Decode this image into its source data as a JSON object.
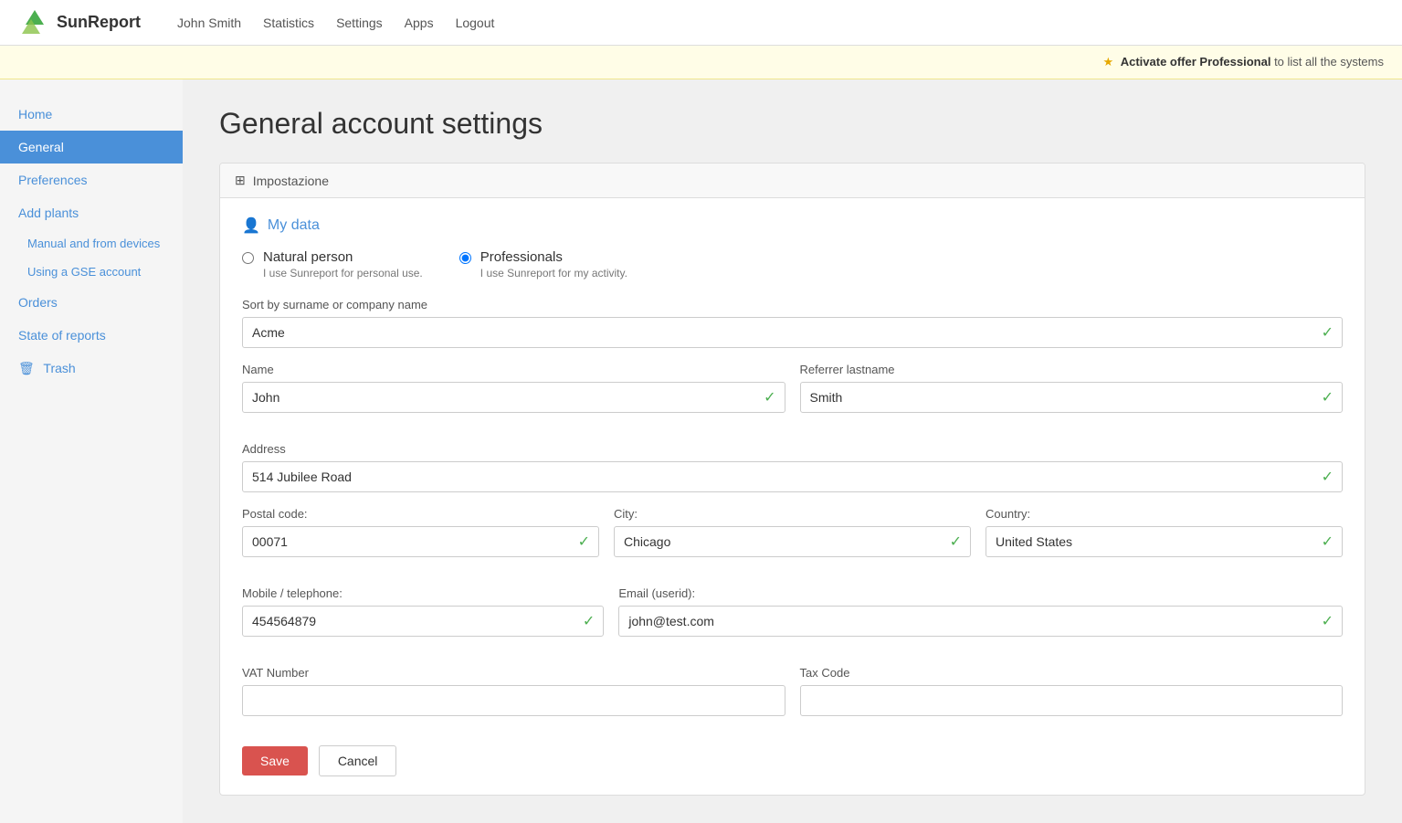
{
  "header": {
    "logo_text": "SunReport",
    "nav": [
      {
        "label": "John Smith",
        "id": "john-smith"
      },
      {
        "label": "Statistics",
        "id": "statistics"
      },
      {
        "label": "Settings",
        "id": "settings"
      },
      {
        "label": "Apps",
        "id": "apps"
      },
      {
        "label": "Logout",
        "id": "logout"
      }
    ]
  },
  "banner": {
    "star": "★",
    "text_bold": "Activate offer Professional",
    "text_rest": " to list all the systems"
  },
  "sidebar": {
    "items": [
      {
        "label": "Home",
        "id": "home",
        "active": false,
        "sub": false
      },
      {
        "label": "General",
        "id": "general",
        "active": true,
        "sub": false
      },
      {
        "label": "Preferences",
        "id": "preferences",
        "active": false,
        "sub": false
      },
      {
        "label": "Add plants",
        "id": "add-plants",
        "active": false,
        "sub": false
      },
      {
        "label": "Manual and from devices",
        "id": "manual-devices",
        "active": false,
        "sub": true
      },
      {
        "label": "Using a GSE account",
        "id": "gse-account",
        "active": false,
        "sub": true
      },
      {
        "label": "Orders",
        "id": "orders",
        "active": false,
        "sub": false
      },
      {
        "label": "State of reports",
        "id": "state-reports",
        "active": false,
        "sub": false
      },
      {
        "label": "Trash",
        "id": "trash",
        "active": false,
        "sub": false,
        "icon": "🗑"
      }
    ]
  },
  "page": {
    "title": "General account settings",
    "card_header": "Impostazione",
    "section_title": "My data",
    "radio_natural": {
      "label": "Natural person",
      "desc": "I use Sunreport for personal use.",
      "checked": false
    },
    "radio_professional": {
      "label": "Professionals",
      "desc": "I use Sunreport for my activity.",
      "checked": true
    },
    "fields": {
      "sort_label": "Sort by surname or company name",
      "sort_value": "Acme",
      "name_label": "Name",
      "name_value": "John",
      "lastname_label": "Referrer lastname",
      "lastname_value": "Smith",
      "address_label": "Address",
      "address_value": "514 Jubilee Road",
      "postal_label": "Postal code:",
      "postal_value": "00071",
      "city_label": "City:",
      "city_value": "Chicago",
      "country_label": "Country:",
      "country_value": "United States",
      "mobile_label": "Mobile / telephone:",
      "mobile_value": "454564879",
      "email_label": "Email (userid):",
      "email_value": "john@test.com",
      "vat_label": "VAT Number",
      "vat_value": "",
      "taxcode_label": "Tax Code",
      "taxcode_value": ""
    },
    "save_label": "Save",
    "cancel_label": "Cancel"
  }
}
